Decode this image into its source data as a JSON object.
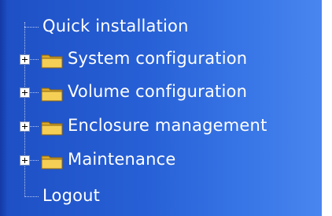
{
  "menu": {
    "items": [
      {
        "label": "Quick installation",
        "type": "leaf"
      },
      {
        "label": "System configuration",
        "type": "folder",
        "expanded": false
      },
      {
        "label": "Volume configuration",
        "type": "folder",
        "expanded": false
      },
      {
        "label": "Enclosure management",
        "type": "folder",
        "expanded": false
      },
      {
        "label": "Maintenance",
        "type": "folder",
        "expanded": false
      },
      {
        "label": "Logout",
        "type": "leaf"
      }
    ]
  },
  "colors": {
    "panel_start": "#1e4fc4",
    "panel_end": "#4a86ef",
    "text": "#ffffff",
    "folder": "#f2c94c"
  },
  "icons": {
    "expander": "plus-box-icon",
    "folder": "folder-icon"
  }
}
